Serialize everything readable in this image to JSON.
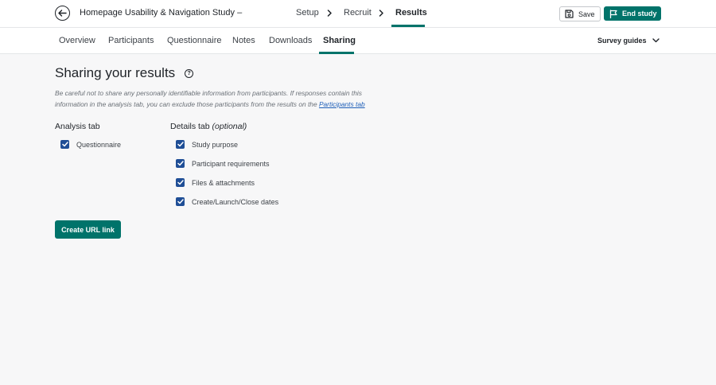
{
  "header": {
    "study_title": "Homepage Usability & Navigation Study – Q...",
    "steps": [
      {
        "label": "Setup"
      },
      {
        "label": "Recruit"
      },
      {
        "label": "Results",
        "active": true
      }
    ],
    "save_label": "Save",
    "end_label": "End study"
  },
  "tabs": [
    {
      "label": "Overview"
    },
    {
      "label": "Participants"
    },
    {
      "label": "Questionnaire"
    },
    {
      "label": "Notes"
    },
    {
      "label": "Downloads"
    },
    {
      "label": "Sharing",
      "active": true
    }
  ],
  "survey_guides_label": "Survey guides",
  "main": {
    "heading": "Sharing your results",
    "warning_text": "Be careful not to share any personally identifiable information from participants. If responses contain this information in the analysis tab, you can exclude those participants from the results on the",
    "warning_link": "Participants tab",
    "analysis": {
      "title": "Analysis tab",
      "items": [
        {
          "label": "Questionnaire",
          "checked": true
        }
      ]
    },
    "details": {
      "title": "Details tab",
      "title_suffix": "(optional)",
      "items": [
        {
          "label": "Study purpose",
          "checked": true
        },
        {
          "label": "Participant requirements",
          "checked": true
        },
        {
          "label": "Files & attachments",
          "checked": true
        },
        {
          "label": "Create/Launch/Close dates",
          "checked": true
        }
      ]
    },
    "create_button": "Create URL link"
  },
  "colors": {
    "accent": "#00736a",
    "checkbox": "#1f4e96",
    "link": "#1f5fb8"
  }
}
